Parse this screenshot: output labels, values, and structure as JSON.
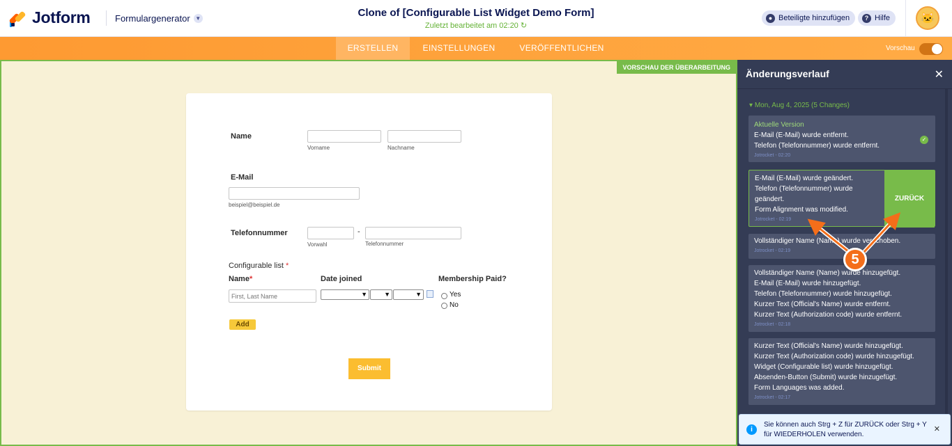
{
  "header": {
    "logo": "Jotform",
    "form_builder": "Formulargenerator",
    "title": "Clone of [Configurable List Widget Demo Form]",
    "last_edited": "Zuletzt bearbeitet am 02:20",
    "add_participants": "Beteiligte hinzufügen",
    "help": "Hilfe"
  },
  "nav": {
    "tabs": [
      {
        "label": "ERSTELLEN"
      },
      {
        "label": "EINSTELLUNGEN"
      },
      {
        "label": "VERÖFFENTLICHEN"
      }
    ],
    "preview_label": "Vorschau"
  },
  "canvas": {
    "revision_preview": "VORSCHAU DER ÜBERARBEITUNG"
  },
  "form": {
    "name_label": "Name",
    "first_name_sub": "Vorname",
    "last_name_sub": "Nachname",
    "email_label": "E-Mail",
    "email_sub": "beispiel@beispiel.de",
    "phone_label": "Telefonnummer",
    "area_code_sub": "Vorwahl",
    "phone_sub": "Telefonnummer",
    "phone_dash": "-",
    "config_list_label": "Configurable list",
    "required_mark": "*",
    "col_name": "Name",
    "col_date": "Date joined",
    "col_paid": "Membership Paid?",
    "name_placeholder": "First, Last Name",
    "yes": "Yes",
    "no": "No",
    "add_button": "Add",
    "submit_button": "Submit"
  },
  "panel": {
    "title": "Änderungsverlauf",
    "date_group": "Mon, Aug 4, 2025 (5 Changes)",
    "current_version": "Aktuelle Version",
    "undo_label": "ZURÜCK",
    "entries": [
      {
        "lines": [
          "E-Mail (E-Mail) wurde entfernt.",
          "Telefon (Telefonnummer) wurde entfernt."
        ],
        "time": "Jotrocket - 02:20"
      },
      {
        "lines": [
          "E-Mail (E-Mail) wurde geändert.",
          "Telefon (Telefonnummer) wurde",
          "geändert.",
          "Form Alignment was modified."
        ],
        "time": "Jotrocket - 02:19"
      },
      {
        "lines": [
          "Vollständiger Name (Name) wurde verschoben."
        ],
        "time": "Jotrocket - 02:19"
      },
      {
        "lines": [
          "Vollständiger Name (Name) wurde hinzugefügt.",
          "E-Mail (E-Mail) wurde hinzugefügt.",
          "Telefon (Telefonnummer) wurde hinzugefügt.",
          "Kurzer Text (Official's Name) wurde entfernt.",
          "Kurzer Text (Authorization code) wurde entfernt."
        ],
        "time": "Jotrocket - 02:18"
      },
      {
        "lines": [
          "Kurzer Text (Official's Name) wurde hinzugefügt.",
          "Kurzer Text (Authorization code) wurde hinzugefügt.",
          "Widget (Configurable list) wurde hinzugefügt.",
          "Absenden-Button (Submit) wurde hinzugefügt.",
          "Form Languages was added."
        ],
        "time": "Jotrocket - 02:17"
      }
    ]
  },
  "info_toast": {
    "text": "Sie können auch Strg + Z für ZURÜCK oder Strg + Y für WIEDERHOLEN verwenden."
  },
  "annotation": {
    "step": "5"
  },
  "colors": {
    "brand_navy": "#0a1551",
    "orange": "#ff9f3a",
    "green": "#78bb4a",
    "panel_bg": "#343c55"
  }
}
